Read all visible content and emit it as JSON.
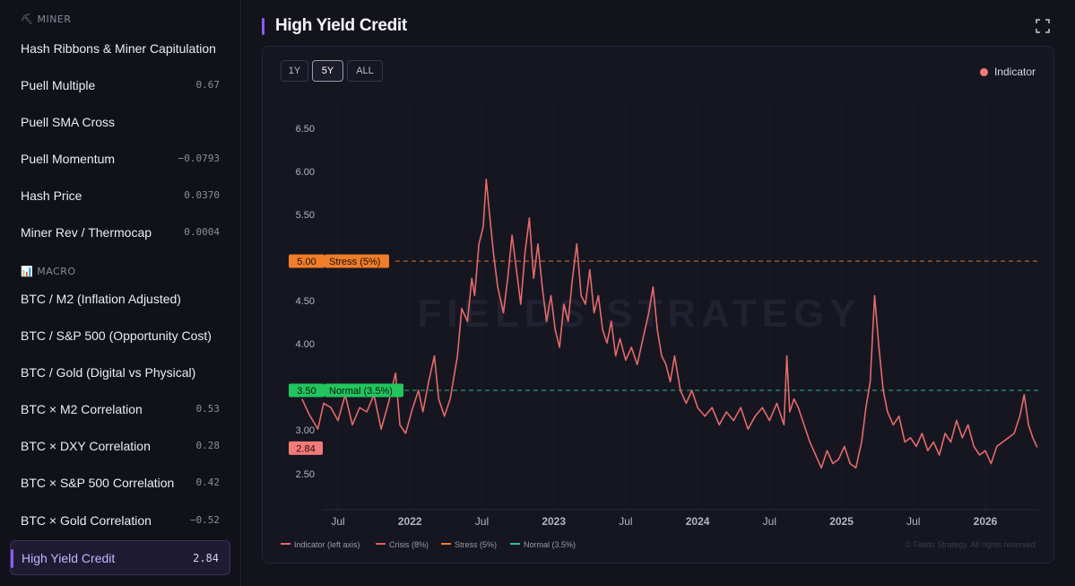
{
  "sidebar": {
    "sections": [
      {
        "title": "MINER",
        "icon": "pickaxe-icon",
        "glyph": "⛏"
      },
      {
        "title": "MACRO",
        "icon": "bar-chart-icon",
        "glyph": "📊"
      }
    ],
    "items": [
      {
        "label": "Hash Ribbons & Miner Capitulation",
        "value": ""
      },
      {
        "label": "Puell Multiple",
        "value": "0.67"
      },
      {
        "label": "Puell SMA Cross",
        "value": ""
      },
      {
        "label": "Puell Momentum",
        "value": "−0.0793"
      },
      {
        "label": "Hash Price",
        "value": "0.0370"
      },
      {
        "label": "Miner Rev / Thermocap",
        "value": "0.0004"
      },
      {
        "label": "BTC / M2 (Inflation Adjusted)",
        "value": ""
      },
      {
        "label": "BTC / S&P 500 (Opportunity Cost)",
        "value": ""
      },
      {
        "label": "BTC / Gold (Digital vs Physical)",
        "value": ""
      },
      {
        "label": "BTC × M2 Correlation",
        "value": "0.53"
      },
      {
        "label": "BTC × DXY Correlation",
        "value": "0.28"
      },
      {
        "label": "BTC × S&P 500 Correlation",
        "value": "0.42"
      },
      {
        "label": "BTC × Gold Correlation",
        "value": "−0.52"
      },
      {
        "label": "High Yield Credit",
        "value": "2.84"
      }
    ],
    "active_item": "High Yield Credit"
  },
  "header": {
    "title": "High Yield Credit",
    "expand_icon": "expand-icon"
  },
  "range_buttons": {
    "labels": [
      "1Y",
      "5Y",
      "ALL"
    ],
    "selected": "5Y"
  },
  "watermark": "FIELDS STRATEGY",
  "copyright": "© Fields Strategy. All rights reserved.",
  "colors": {
    "accent": "#8b5cf6",
    "indicator": "#e46a6a",
    "crisis": "#e05d5d",
    "stress": "#f07d2a",
    "normal": "#2fbf8f",
    "normal_badge": "#22c55e",
    "current_badge": "#f27a7a"
  },
  "chart_data": {
    "type": "line",
    "title": "High Yield Credit",
    "top_legend": "Indicator",
    "ylim": [
      2.3,
      6.9
    ],
    "y_ticks": [
      "2.50",
      "3.00",
      "4.00",
      "4.50",
      "5.50",
      "6.00",
      "6.50"
    ],
    "x_ticks": [
      "Jul",
      "2022",
      "Jul",
      "2023",
      "Jul",
      "2024",
      "Jul",
      "2025",
      "Jul",
      "2026"
    ],
    "x_tick_positions": [
      2021.5,
      2022.0,
      2022.5,
      2023.0,
      2023.5,
      2024.0,
      2024.5,
      2025.0,
      2025.5,
      2026.0
    ],
    "xlim": [
      2021.25,
      2026.49
    ],
    "reference_lines": [
      {
        "name": "Stress (5%)",
        "value": 5.0,
        "badge": "5.00",
        "label": "Stress (5%)"
      },
      {
        "name": "Normal (3.5%)",
        "value": 3.5,
        "badge": "3.50",
        "label": "Normal (3.5%)"
      }
    ],
    "current_value": {
      "value": 2.84,
      "badge": "2.84"
    },
    "legend_bottom": [
      "Indicator (left axis)",
      "Crisis (8%)",
      "Stress (5%)",
      "Normal (3.5%)"
    ],
    "series": [
      {
        "name": "Indicator",
        "points": [
          [
            2021.25,
            3.4
          ],
          [
            2021.3,
            3.22
          ],
          [
            2021.36,
            3.05
          ],
          [
            2021.4,
            3.35
          ],
          [
            2021.45,
            3.3
          ],
          [
            2021.5,
            3.15
          ],
          [
            2021.55,
            3.45
          ],
          [
            2021.6,
            3.1
          ],
          [
            2021.65,
            3.3
          ],
          [
            2021.7,
            3.25
          ],
          [
            2021.75,
            3.45
          ],
          [
            2021.8,
            3.05
          ],
          [
            2021.85,
            3.35
          ],
          [
            2021.9,
            3.7
          ],
          [
            2021.93,
            3.1
          ],
          [
            2021.97,
            3.0
          ],
          [
            2022.02,
            3.3
          ],
          [
            2022.06,
            3.5
          ],
          [
            2022.09,
            3.25
          ],
          [
            2022.13,
            3.6
          ],
          [
            2022.17,
            3.9
          ],
          [
            2022.2,
            3.4
          ],
          [
            2022.24,
            3.2
          ],
          [
            2022.28,
            3.4
          ],
          [
            2022.33,
            3.9
          ],
          [
            2022.36,
            4.45
          ],
          [
            2022.4,
            4.3
          ],
          [
            2022.43,
            4.8
          ],
          [
            2022.45,
            4.6
          ],
          [
            2022.48,
            5.2
          ],
          [
            2022.51,
            5.4
          ],
          [
            2022.53,
            5.95
          ],
          [
            2022.55,
            5.6
          ],
          [
            2022.58,
            5.1
          ],
          [
            2022.61,
            4.7
          ],
          [
            2022.65,
            4.4
          ],
          [
            2022.68,
            4.8
          ],
          [
            2022.71,
            5.3
          ],
          [
            2022.74,
            4.9
          ],
          [
            2022.77,
            4.5
          ],
          [
            2022.8,
            5.1
          ],
          [
            2022.83,
            5.5
          ],
          [
            2022.86,
            4.8
          ],
          [
            2022.89,
            5.2
          ],
          [
            2022.92,
            4.7
          ],
          [
            2022.95,
            4.3
          ],
          [
            2022.98,
            4.6
          ],
          [
            2023.01,
            4.2
          ],
          [
            2023.04,
            4.0
          ],
          [
            2023.07,
            4.5
          ],
          [
            2023.1,
            4.3
          ],
          [
            2023.13,
            4.8
          ],
          [
            2023.16,
            5.2
          ],
          [
            2023.19,
            4.6
          ],
          [
            2023.22,
            4.5
          ],
          [
            2023.25,
            4.9
          ],
          [
            2023.28,
            4.4
          ],
          [
            2023.31,
            4.6
          ],
          [
            2023.34,
            4.2
          ],
          [
            2023.37,
            4.05
          ],
          [
            2023.4,
            4.3
          ],
          [
            2023.43,
            3.9
          ],
          [
            2023.46,
            4.1
          ],
          [
            2023.5,
            3.85
          ],
          [
            2023.54,
            4.0
          ],
          [
            2023.58,
            3.8
          ],
          [
            2023.62,
            4.1
          ],
          [
            2023.66,
            4.4
          ],
          [
            2023.69,
            4.7
          ],
          [
            2023.72,
            4.2
          ],
          [
            2023.75,
            3.9
          ],
          [
            2023.78,
            3.8
          ],
          [
            2023.81,
            3.6
          ],
          [
            2023.84,
            3.9
          ],
          [
            2023.88,
            3.5
          ],
          [
            2023.92,
            3.35
          ],
          [
            2023.96,
            3.5
          ],
          [
            2024.0,
            3.3
          ],
          [
            2024.05,
            3.2
          ],
          [
            2024.1,
            3.3
          ],
          [
            2024.15,
            3.1
          ],
          [
            2024.2,
            3.25
          ],
          [
            2024.25,
            3.15
          ],
          [
            2024.3,
            3.3
          ],
          [
            2024.35,
            3.05
          ],
          [
            2024.4,
            3.2
          ],
          [
            2024.45,
            3.3
          ],
          [
            2024.5,
            3.15
          ],
          [
            2024.55,
            3.35
          ],
          [
            2024.58,
            3.2
          ],
          [
            2024.6,
            3.1
          ],
          [
            2024.62,
            3.9
          ],
          [
            2024.64,
            3.25
          ],
          [
            2024.67,
            3.4
          ],
          [
            2024.7,
            3.3
          ],
          [
            2024.74,
            3.1
          ],
          [
            2024.78,
            2.9
          ],
          [
            2024.82,
            2.75
          ],
          [
            2024.86,
            2.6
          ],
          [
            2024.9,
            2.8
          ],
          [
            2024.94,
            2.65
          ],
          [
            2024.98,
            2.7
          ],
          [
            2025.02,
            2.85
          ],
          [
            2025.06,
            2.65
          ],
          [
            2025.1,
            2.6
          ],
          [
            2025.14,
            2.9
          ],
          [
            2025.17,
            3.3
          ],
          [
            2025.2,
            3.6
          ],
          [
            2025.23,
            4.6
          ],
          [
            2025.26,
            4.0
          ],
          [
            2025.29,
            3.5
          ],
          [
            2025.32,
            3.25
          ],
          [
            2025.36,
            3.1
          ],
          [
            2025.4,
            3.2
          ],
          [
            2025.44,
            2.9
          ],
          [
            2025.48,
            2.95
          ],
          [
            2025.52,
            2.85
          ],
          [
            2025.56,
            3.0
          ],
          [
            2025.6,
            2.8
          ],
          [
            2025.64,
            2.9
          ],
          [
            2025.68,
            2.75
          ],
          [
            2025.72,
            3.0
          ],
          [
            2025.76,
            2.9
          ],
          [
            2025.8,
            3.15
          ],
          [
            2025.84,
            2.95
          ],
          [
            2025.88,
            3.1
          ],
          [
            2025.92,
            2.85
          ],
          [
            2025.96,
            2.75
          ],
          [
            2026.0,
            2.8
          ],
          [
            2026.04,
            2.65
          ],
          [
            2026.08,
            2.85
          ],
          [
            2026.12,
            2.9
          ],
          [
            2026.16,
            2.95
          ],
          [
            2026.2,
            3.0
          ],
          [
            2026.24,
            3.2
          ],
          [
            2026.27,
            3.45
          ],
          [
            2026.3,
            3.1
          ],
          [
            2026.33,
            2.95
          ],
          [
            2026.36,
            2.84
          ]
        ]
      }
    ]
  }
}
